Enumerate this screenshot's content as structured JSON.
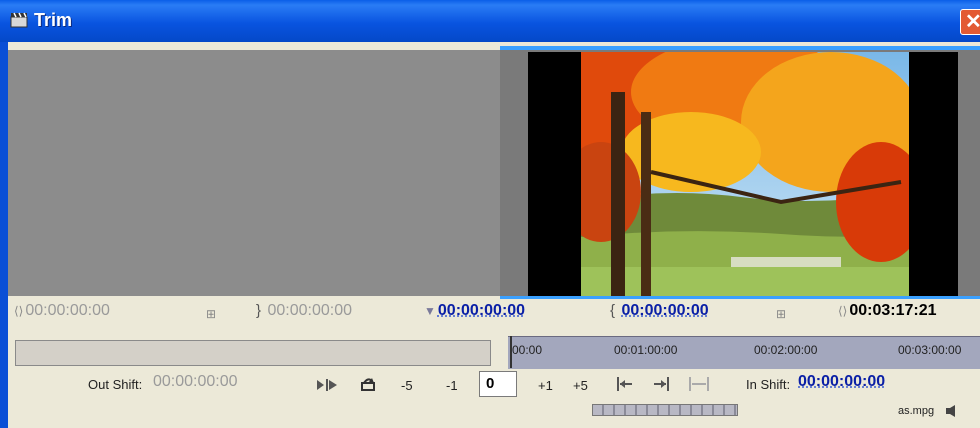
{
  "window": {
    "title": "Trim",
    "close_glyph": "✕"
  },
  "timecodes": {
    "left_in": "00:00:00:00",
    "left_out": "00:00:00:00",
    "center_marker": "00:00:00:00",
    "right_in": "00:00:00:00",
    "right_duration": "00:03:17:21"
  },
  "timeline": {
    "ticks": [
      "00:00",
      "00:01:00:00",
      "00:02:00:00",
      "00:03:00:00"
    ]
  },
  "controls": {
    "out_shift_label": "Out Shift:",
    "out_shift_value": "00:00:00:00",
    "minus5": "-5",
    "minus1": "-1",
    "frame_value": "0",
    "plus1": "+1",
    "plus5": "+5",
    "in_shift_label": "In Shift:",
    "in_shift_value": "00:00:00:00"
  },
  "clip": {
    "filename": "as.mpg"
  },
  "colors": {
    "titlebar": "#0954e0",
    "accent_blue": "#3aa0ff",
    "timecode_blue": "#0a1fa6"
  }
}
